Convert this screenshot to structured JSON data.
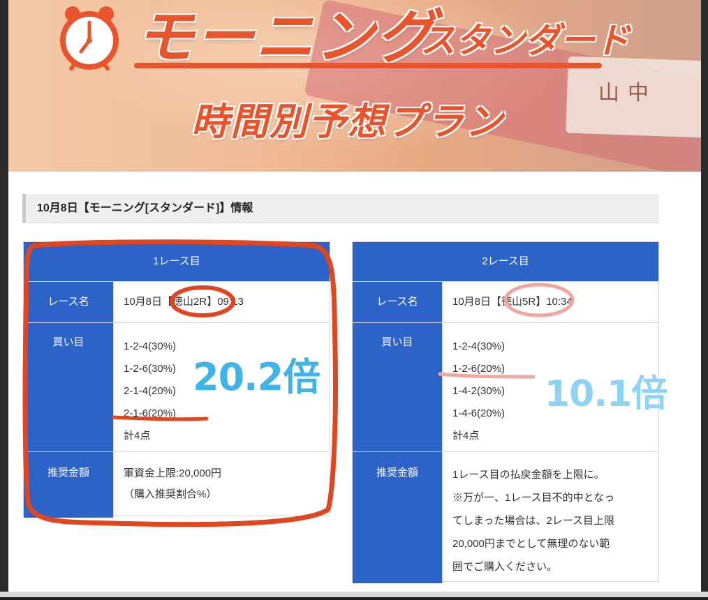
{
  "banner": {
    "title_main": "モーニング",
    "title_sub": "スタンダード",
    "title_plan": "時間別予想プラン",
    "plate_text": "山中"
  },
  "section": {
    "header": "10月8日【モーニング[スタンダード]】情報"
  },
  "races": [
    {
      "head": "1レース目",
      "name_label": "レース名",
      "name_value": "10月8日【徳山2R】09:13",
      "buy_label": "買い目",
      "buy_lines": [
        "1-2-4(30%)",
        "1-2-6(30%)",
        "2-1-4(20%)",
        "2-1-6(20%)",
        "計4点"
      ],
      "amount_label": "推奨金額",
      "amount_lines": [
        "軍資金上限:20,000円",
        "（購入推奨割合%）"
      ]
    },
    {
      "head": "2レース目",
      "name_label": "レース名",
      "name_value": "10月8日【徳山5R】10:34",
      "buy_label": "買い目",
      "buy_lines": [
        "1-2-4(30%)",
        "1-2-6(20%)",
        "1-4-2(30%)",
        "1-4-6(20%)",
        "計4点"
      ],
      "amount_label": "推奨金額",
      "amount_lines": [
        "1レース目の払戻金額を上限に。",
        "※万が一、1レース目不的中となっ",
        "てしまった場合は、2レース目上限",
        "20,000円までとして無理のない範",
        "囲でご購入ください。"
      ]
    }
  ],
  "annotations": {
    "odds_1": "20.2倍",
    "odds_2": "10.1倍",
    "color_red": "#e0461f",
    "color_pink": "#f2a6a0",
    "color_blue": "#3fb4e6"
  }
}
